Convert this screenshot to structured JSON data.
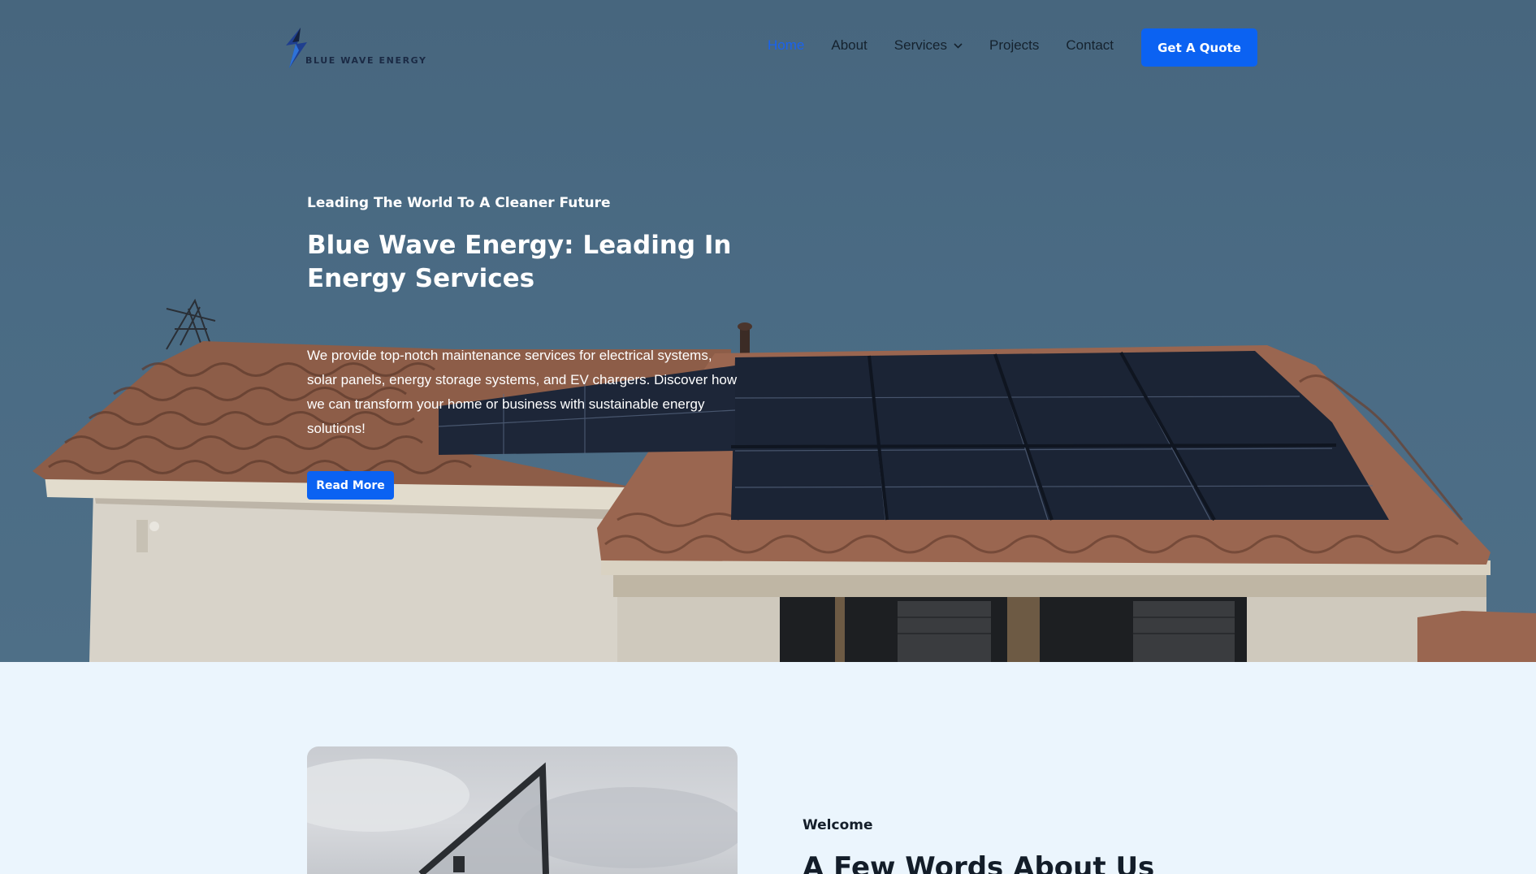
{
  "brand": {
    "name": "BLUE WAVE ENERGY",
    "accent": "#0b62f2"
  },
  "nav": {
    "items": [
      {
        "label": "Home",
        "active": true
      },
      {
        "label": "About"
      },
      {
        "label": "Services",
        "has_dropdown": true
      },
      {
        "label": "Projects"
      },
      {
        "label": "Contact"
      }
    ],
    "cta_label": "Get A Quote"
  },
  "hero": {
    "eyebrow": "Leading The World To A Cleaner Future",
    "title": "Blue Wave Energy: Leading In Energy Services",
    "description": "We provide top-notch maintenance services for electrical systems, solar panels, energy storage systems, and EV chargers. Discover how we can transform your home or business with sustainable energy solutions!",
    "button_label": "Read More"
  },
  "about": {
    "eyebrow": "Welcome",
    "title": "A Few Words About Us"
  }
}
